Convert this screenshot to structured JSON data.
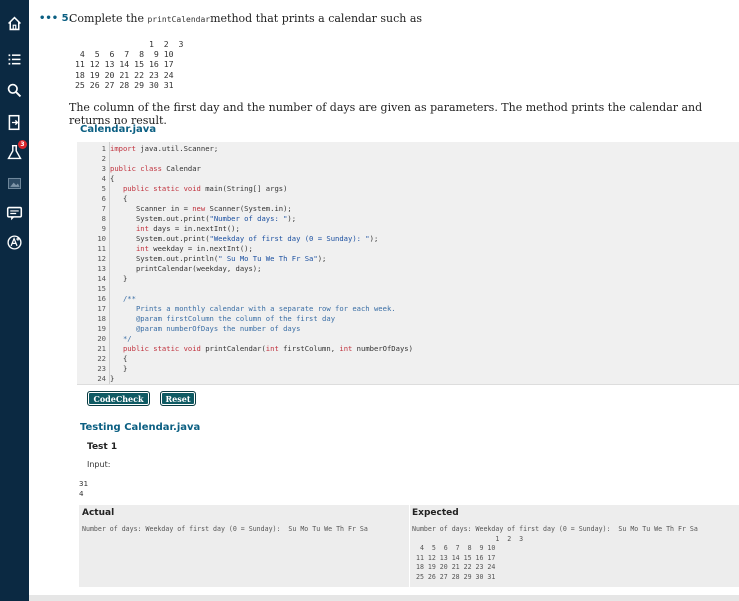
{
  "sidebar": {
    "icons": [
      "home-icon",
      "list-icon",
      "search-icon",
      "exit-door-icon",
      "lab-flask-icon",
      "image-icon",
      "chat-icon",
      "accessibility-text-icon"
    ],
    "flask_badge": "3"
  },
  "question": {
    "number": "••• 5.",
    "text_before": "Complete the ",
    "method_name": "printCalendar",
    "text_after": "method that prints a calendar such as",
    "sample_calendar": "               1  2  3\n 4  5  6  7  8  9 10\n11 12 13 14 15 16 17\n18 19 20 21 22 23 24\n25 26 27 28 29 30 31",
    "description": "The column of the first day and the number of days are given as parameters. The method prints the calendar and returns no result."
  },
  "editor": {
    "file_title": "Calendar.java"
  },
  "buttons": {
    "codecheck": "CodeCheck",
    "reset": "Reset"
  },
  "testing": {
    "title": "Testing Calendar.java",
    "test_label": "Test 1",
    "input_label": "Input:",
    "input_values": "31\n4",
    "actual_header": "Actual",
    "expected_header": "Expected",
    "actual_output": "Number of days: Weekday of first day (0 = Sunday):  Su Mo Tu We Th Fr Sa",
    "expected_output": "Number of days: Weekday of first day (0 = Sunday):  Su Mo Tu We Th Fr Sa\n                     1  2  3\n  4  5  6  7  8  9 10\n 11 12 13 14 15 16 17\n 18 19 20 21 22 23 24\n 25 26 27 28 29 30 31"
  },
  "colors": {
    "sidebar": "#0b2942",
    "title_blue": "#0b5f82",
    "button": "#0e5a63",
    "keyword": "#c0313d",
    "string": "#1a4fa0"
  }
}
